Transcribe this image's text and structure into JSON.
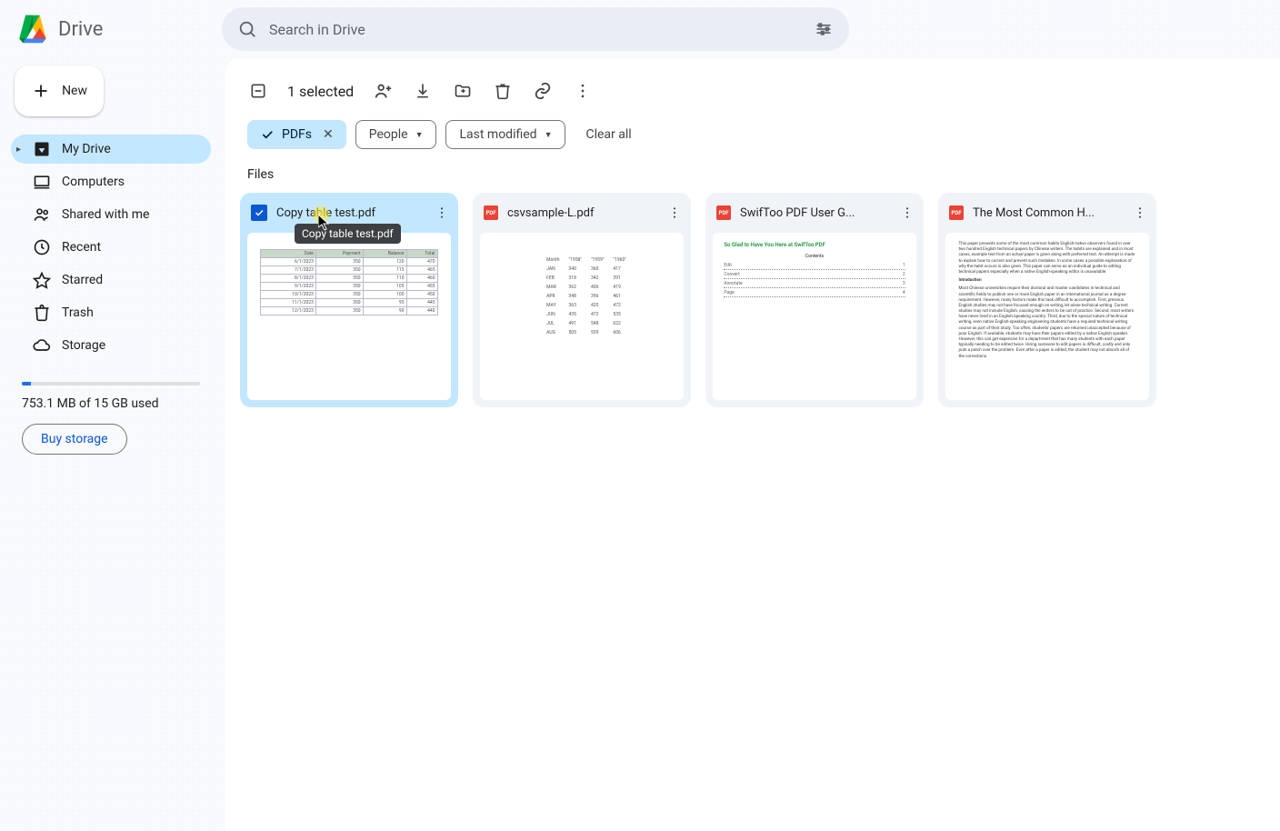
{
  "header": {
    "app_name": "Drive",
    "search_placeholder": "Search in Drive"
  },
  "sidebar": {
    "new_label": "New",
    "items": [
      {
        "label": "My Drive"
      },
      {
        "label": "Computers"
      },
      {
        "label": "Shared with me"
      },
      {
        "label": "Recent"
      },
      {
        "label": "Starred"
      },
      {
        "label": "Trash"
      },
      {
        "label": "Storage"
      }
    ],
    "storage_text": "753.1 MB of 15 GB used",
    "buy_label": "Buy storage"
  },
  "toolbar": {
    "selection_count": "1 selected"
  },
  "filters": {
    "pdfs": "PDFs",
    "people": "People",
    "modified": "Last modified",
    "clear": "Clear all"
  },
  "section_label": "Files",
  "files": [
    {
      "name": "Copy table test.pdf",
      "tooltip": "Copy table test.pdf",
      "selected": true
    },
    {
      "name": "csvsample-L.pdf",
      "selected": false
    },
    {
      "name": "SwifToo PDF User G...",
      "selected": false
    },
    {
      "name": "The Most Common H...",
      "selected": false
    }
  ]
}
